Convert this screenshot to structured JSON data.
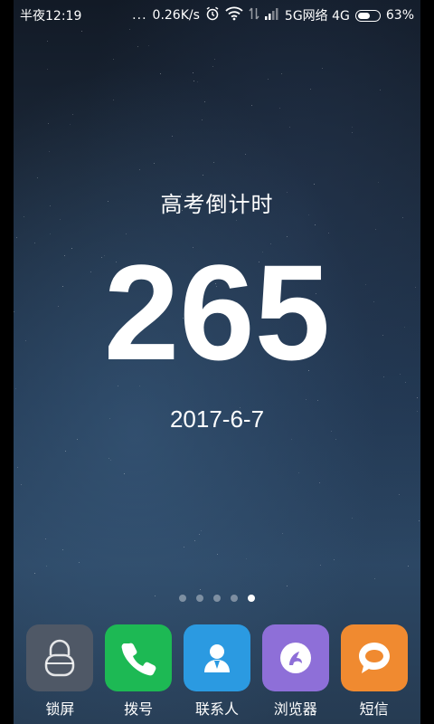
{
  "status_bar": {
    "time": "半夜12:19",
    "dots": "...",
    "speed": "0.26K/s",
    "network_label": "5G网络 4G",
    "battery_text": "63%",
    "battery_level": 0.63
  },
  "widget": {
    "title": "高考倒计时",
    "days": "265",
    "date": "2017-6-7"
  },
  "page_indicator": {
    "count": 5,
    "active_index": 4
  },
  "dock": {
    "apps": [
      {
        "label": "锁屏",
        "icon": "lock-icon",
        "color": "#4f5866"
      },
      {
        "label": "拨号",
        "icon": "phone-icon",
        "color": "#1db954"
      },
      {
        "label": "联系人",
        "icon": "contact-icon",
        "color": "#2b9ae1"
      },
      {
        "label": "浏览器",
        "icon": "browser-icon",
        "color": "#8e6fd8"
      },
      {
        "label": "短信",
        "icon": "message-icon",
        "color": "#f08a30"
      }
    ]
  }
}
